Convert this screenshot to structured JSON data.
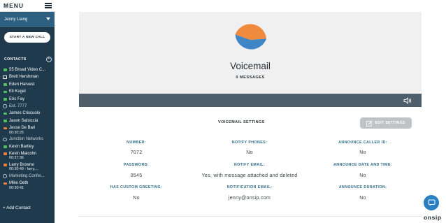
{
  "sidebar": {
    "menu_label": "MENU",
    "user_name": "Jenny Liang",
    "new_call_label": "START A NEW CALL",
    "contacts_label": "CONTACTS",
    "add_contact_label": "+ Add Contact",
    "contacts": [
      {
        "name": "55 Broad Video C...",
        "status": "green"
      },
      {
        "name": "Brett Hershman",
        "status": "outline"
      },
      {
        "name": "Eden Harvest",
        "status": "green"
      },
      {
        "name": "Eli Kugel",
        "status": "green"
      },
      {
        "name": "Eric Fay",
        "status": "green"
      },
      {
        "name": "Ext. 7777",
        "status": "dot"
      },
      {
        "name": "James Criscuolo",
        "status": "green"
      },
      {
        "name": "Jason Salsiccia",
        "status": "green"
      },
      {
        "name": "Jesse De Bari",
        "status": "orange",
        "sub": "00:30:25"
      },
      {
        "name": "Junction Networks",
        "status": "dot"
      },
      {
        "name": "Kevin Bartley",
        "status": "green"
      },
      {
        "name": "Kevin Malcolm",
        "status": "orange",
        "sub": "00:27:36"
      },
      {
        "name": "Larry Browne",
        "status": "orange",
        "sub": "00:30:49 - larry,..."
      },
      {
        "name": "Marketing Confer...",
        "status": "dot"
      },
      {
        "name": "Mike Oeth",
        "status": "orange",
        "sub": "00:30:41"
      }
    ]
  },
  "voicemail": {
    "title": "Voicemail",
    "count_label": "0 MESSAGES",
    "settings_title": "VOICEMAIL SETTINGS",
    "edit_label": "EDIT SETTINGS"
  },
  "fields": [
    {
      "label": "NUMBER:",
      "value": "7072"
    },
    {
      "label": "NOTIFY PHONES:",
      "value": "No"
    },
    {
      "label": "ANNOUNCE CALLER ID:",
      "value": "No"
    },
    {
      "label": "PASSWORD:",
      "value": "0545"
    },
    {
      "label": "NOTIFY EMAIL:",
      "value": "Yes, with message attached and deleted"
    },
    {
      "label": "ANNOUNCE DATE AND TIME:",
      "value": "No"
    },
    {
      "label": "HAS CUSTOM GREETING:",
      "value": "No"
    },
    {
      "label": "NOTIFICATION EMAIL:",
      "value": "jenny@onsip.com"
    },
    {
      "label": "ANNOUNCE DURATION:",
      "value": "No"
    }
  ],
  "brand": "onsip",
  "colors": {
    "sidebar_bg": "#1e3a4c",
    "user_row_bg": "#2d5f80",
    "status_green": "#4fc15d",
    "status_orange": "#f07d3a",
    "label_blue": "#2f6b8a",
    "pie_orange": "#f08a3c",
    "pie_blue": "#3f86c6",
    "player_bar": "#4e5e6a",
    "chat_button": "#2a7fc0"
  },
  "icons": [
    "menu-icon",
    "chevron-down-icon",
    "add-contact-icon",
    "chat-bubble-icon",
    "presence-dot-icon",
    "voicemail-pie-icon",
    "speaker-icon",
    "edit-icon",
    "chat-support-icon"
  ]
}
